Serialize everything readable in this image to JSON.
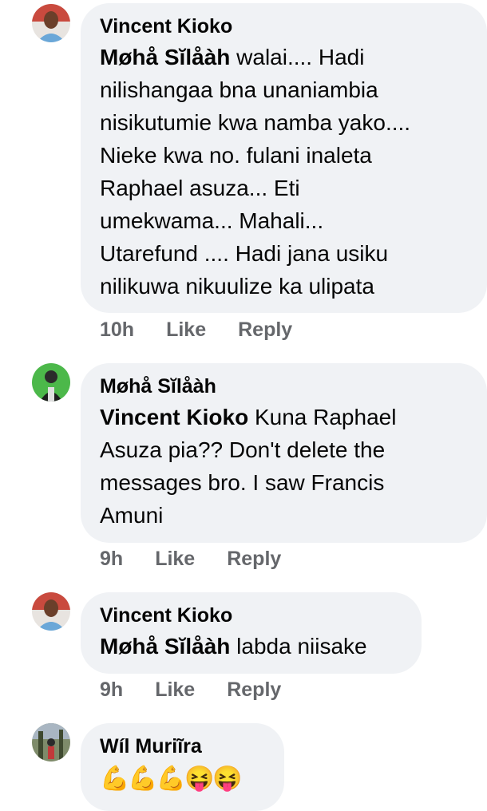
{
  "comments": [
    {
      "author": "Vincent Kioko",
      "tag": "Møhå Sĭlåàh",
      "lines": [
        " walai.... Hadi",
        "nilishangaa bna unaniambia",
        "nisikutumie kwa namba yako....",
        "Nieke kwa no. fulani inaleta",
        "Raphael asuza... Eti",
        "umekwama... Mahali...",
        "Utarefund .... Hadi jana usiku",
        "nilikuwa nikuulize ka ulipata"
      ],
      "time": "10h",
      "like": "Like",
      "reply": "Reply",
      "avatar_color": "#c9423a"
    },
    {
      "author": "Møhå Sĭlåàh",
      "tag": "Vincent Kioko",
      "lines": [
        " Kuna Raphael",
        "Asuza pia?? Don't delete the",
        "messages bro. I saw Francis",
        "Amuni"
      ],
      "time": "9h",
      "like": "Like",
      "reply": "Reply",
      "avatar_color": "#3aa84a"
    },
    {
      "author": "Vincent Kioko",
      "tag": "Møhå Sĭlåàh",
      "lines": [
        " labda niisake"
      ],
      "time": "9h",
      "like": "Like",
      "reply": "Reply",
      "avatar_color": "#c9423a"
    },
    {
      "author": "Wíl Muriĩra",
      "emojis": "💪💪💪😝😝",
      "avatar_color": "#5a6b4a"
    }
  ],
  "colors": {
    "bubble": "#f0f2f5",
    "meta": "#65676b",
    "text": "#050505"
  }
}
